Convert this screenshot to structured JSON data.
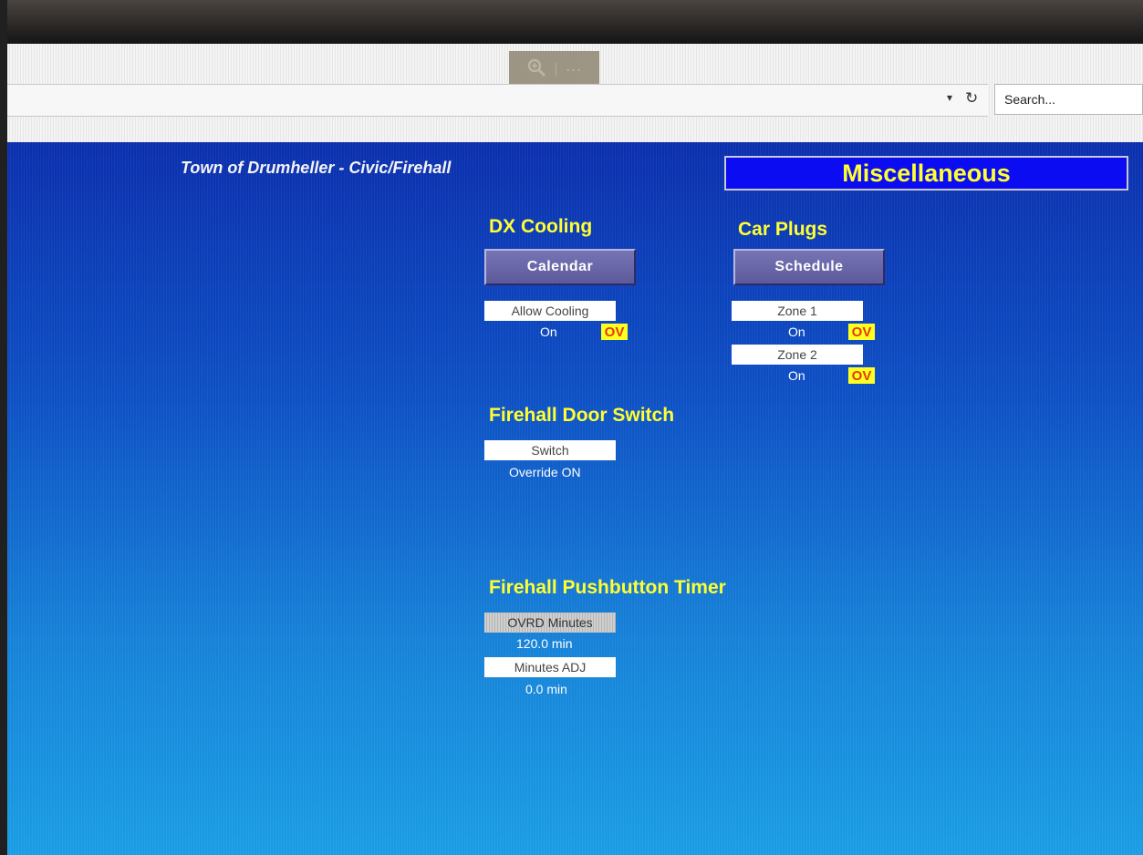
{
  "browser": {
    "zoom_icon": "magnifier-plus-icon",
    "zoom_separator": "|",
    "more_dots": "···",
    "dropdown_icon": "▾",
    "reload_icon": "↻",
    "search_placeholder": "Search..."
  },
  "header": {
    "site_title": "Town of Drumheller - Civic/Firehall",
    "page_title": "Miscellaneous"
  },
  "dx_cooling": {
    "title": "DX Cooling",
    "button_label": "Calendar",
    "point_label": "Allow Cooling",
    "point_value": "On",
    "override_badge": "OV"
  },
  "car_plugs": {
    "title": "Car Plugs",
    "button_label": "Schedule",
    "zones": [
      {
        "label": "Zone 1",
        "value": "On",
        "badge": "OV"
      },
      {
        "label": "Zone 2",
        "value": "On",
        "badge": "OV"
      }
    ]
  },
  "door_switch": {
    "title": "Firehall Door Switch",
    "point_label": "Switch",
    "point_value": "Override ON"
  },
  "pushbutton_timer": {
    "title": "Firehall Pushbutton Timer",
    "ovrd_label": "OVRD Minutes",
    "ovrd_value": "120.0 min",
    "adj_label": "Minutes ADJ",
    "adj_value": "0.0 min"
  },
  "colors": {
    "title_yellow": "#ffff33",
    "header_blue": "#0c0cf2",
    "button_purple": "#6a67a8",
    "override_badge_bg": "#ffff22",
    "override_badge_text": "#e23a10"
  }
}
